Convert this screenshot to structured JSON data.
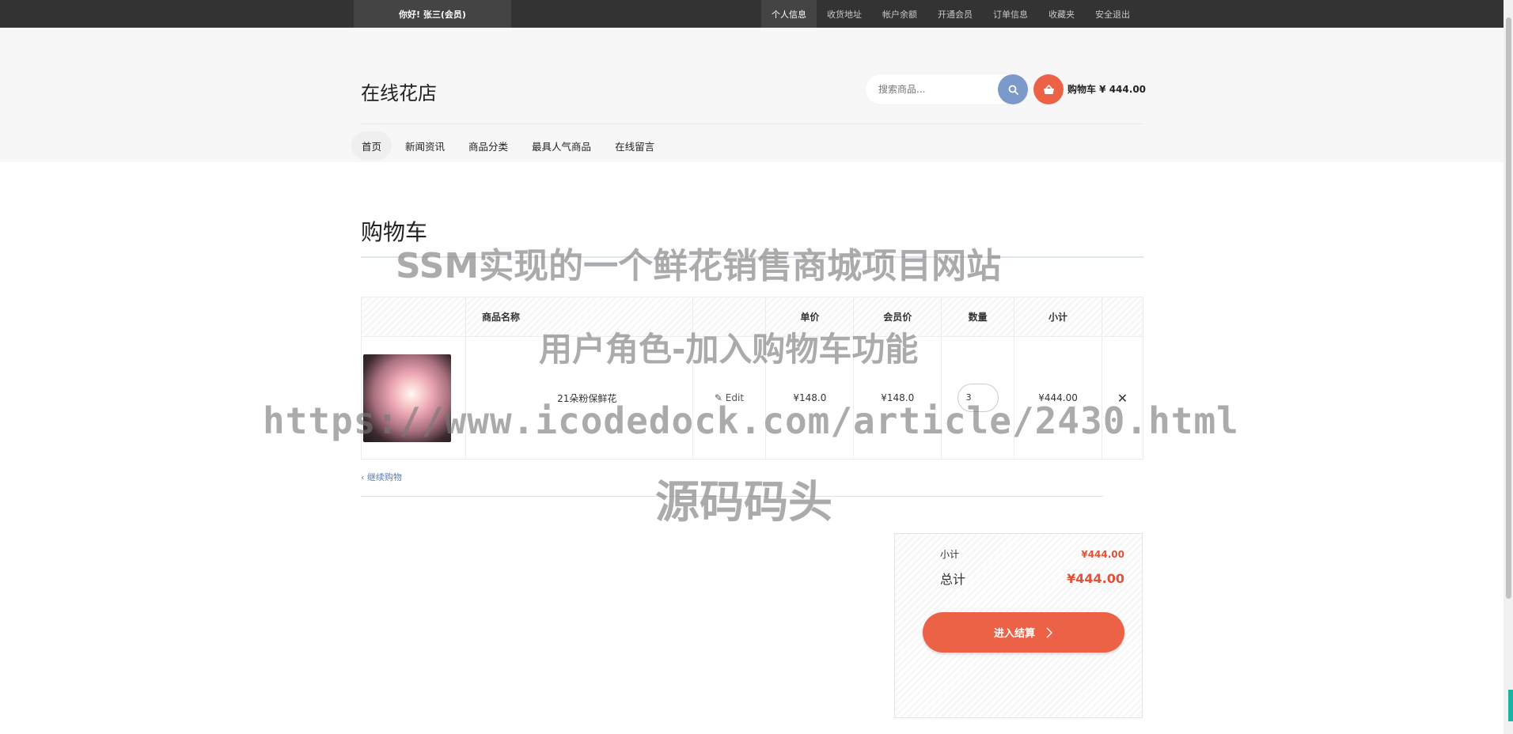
{
  "topbar": {
    "greeting": "你好! 张三(会员)",
    "links": [
      "个人信息",
      "收货地址",
      "帐户余额",
      "开通会员",
      "订单信息",
      "收藏夹",
      "安全退出"
    ],
    "active_index": 0
  },
  "header": {
    "logo": "在线花店",
    "search_placeholder": "搜索商品...",
    "cart_label": "购物车 ¥ 444.00"
  },
  "mainnav": {
    "items": [
      "首页",
      "新闻资讯",
      "商品分类",
      "最具人气商品",
      "在线留言"
    ],
    "active_index": 0
  },
  "page": {
    "title": "购物车"
  },
  "cart": {
    "columns": [
      "",
      "商品名称",
      "",
      "单价",
      "会员价",
      "数量",
      "小计",
      ""
    ],
    "items": [
      {
        "name": "21朵粉保鲜花",
        "edit_label": "Edit",
        "price": "¥148.0",
        "member_price": "¥148.0",
        "quantity": "3",
        "subtotal": "¥444.00"
      }
    ],
    "continue_label": "继续购物"
  },
  "summary": {
    "subtotal_label": "小计",
    "subtotal_value": "¥444.00",
    "total_label": "总计",
    "total_value": "¥444.00",
    "checkout_label": "进入结算"
  },
  "watermark": {
    "line1": "SSM实现的一个鲜花销售商城项目网站",
    "line2": "用户角色-加入购物车功能",
    "line3": "https://www.icodedock.com/article/2430.html",
    "line4": "源码码头"
  },
  "colors": {
    "accent": "#ec6247",
    "search_button": "#7b9ac9",
    "topbar": "#333333"
  }
}
